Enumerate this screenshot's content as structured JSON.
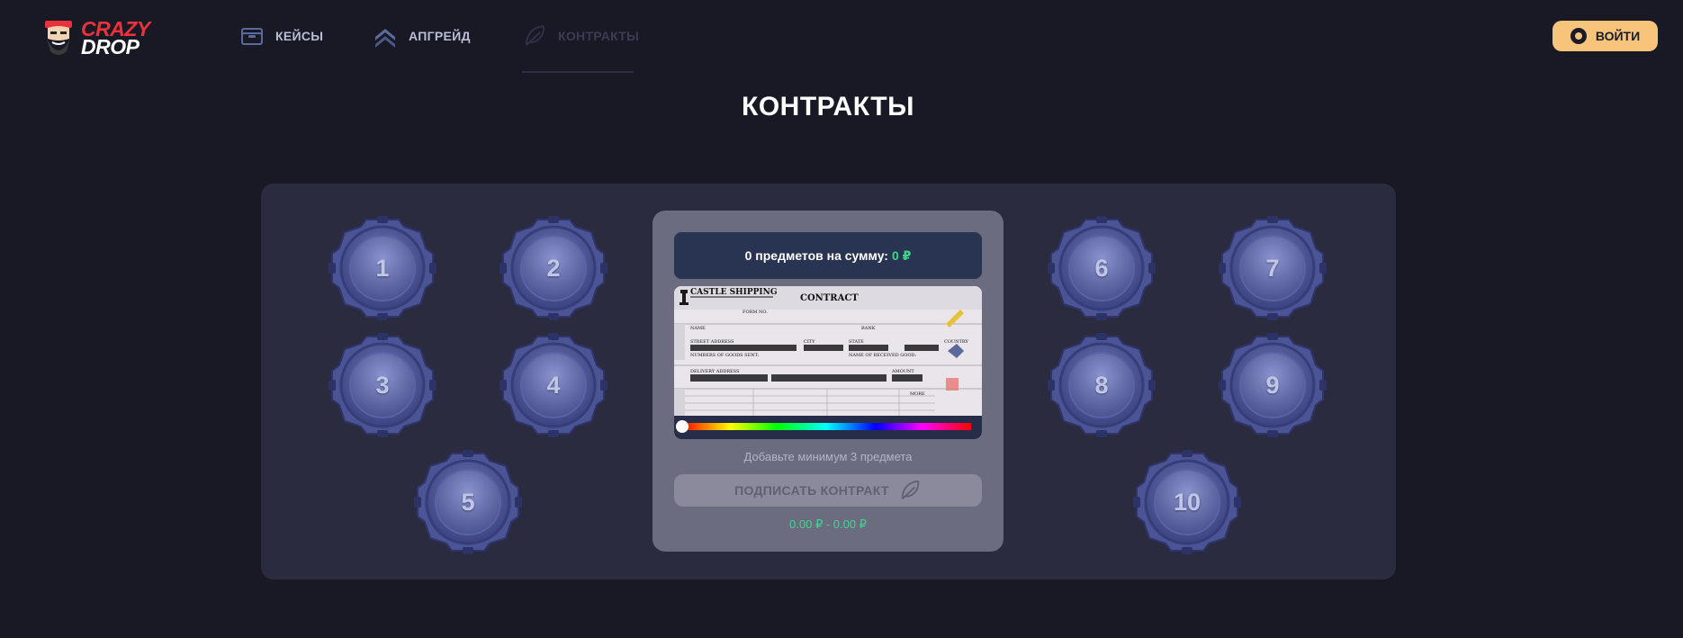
{
  "header": {
    "logo": {
      "line1": "CRAZY",
      "line2": "DROP"
    },
    "nav": [
      {
        "label": "КЕЙСЫ",
        "icon": "wallet-icon"
      },
      {
        "label": "АПГРЕЙД",
        "icon": "chevrons-up-icon"
      },
      {
        "label": "КОНТРАКТЫ",
        "icon": "feather-icon"
      }
    ],
    "login_label": "ВОЙТИ"
  },
  "page": {
    "title": "КОНТРАКТЫ"
  },
  "slots": [
    {
      "label": "1"
    },
    {
      "label": "2"
    },
    {
      "label": "3"
    },
    {
      "label": "4"
    },
    {
      "label": "5"
    },
    {
      "label": "6"
    },
    {
      "label": "7"
    },
    {
      "label": "8"
    },
    {
      "label": "9"
    },
    {
      "label": "10"
    }
  ],
  "contract": {
    "summary_text": "0 предметов на сумму:",
    "summary_price": "0 ₽",
    "doc": {
      "company": "CASTLE SHIPPING",
      "title": "CONTRACT",
      "form_no": "FORM NO.",
      "name": "NAME",
      "rank": "RANK",
      "street": "STREET ADDRESS",
      "city": "CITY",
      "state": "STATE",
      "country": "COUNTRY",
      "goods_sent": "NUMBERS OF GOODS SENT:",
      "received": "NAME OF RECEIVED GOOD:",
      "delivery": "DELIVERY ADDRESS",
      "amount": "AMOUNT",
      "more": "MORE"
    },
    "hint": "Добавьте минимум 3 предмета",
    "sign_label": "ПОДПИСАТЬ КОНТРАКТ",
    "range": "0.00 ₽ - 0.00 ₽"
  },
  "colors": {
    "accent": "#f6c47a",
    "price": "#3fd68c",
    "brand_red": "#e8323c"
  }
}
